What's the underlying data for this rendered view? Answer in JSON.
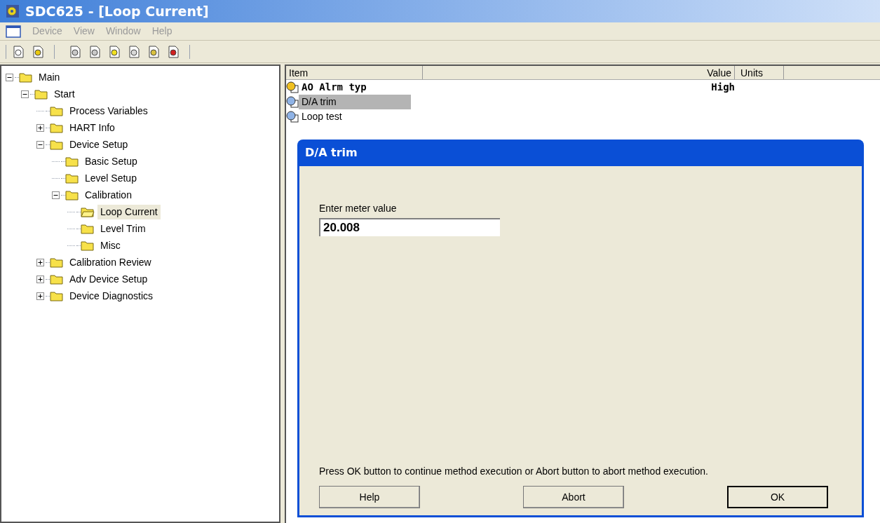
{
  "window": {
    "title": "SDC625 - [Loop Current]"
  },
  "menu": [
    {
      "label": "Device",
      "disabled": true
    },
    {
      "label": "View",
      "disabled": true
    },
    {
      "label": "Window",
      "disabled": true
    },
    {
      "label": "Help",
      "disabled": true
    }
  ],
  "tree": [
    {
      "label": "Main",
      "expanded": true,
      "selected": false,
      "children": [
        {
          "label": "Start",
          "expanded": true,
          "selected": false,
          "children": [
            {
              "label": "Process Variables",
              "selected": false
            },
            {
              "label": "HART Info",
              "expanded": false,
              "selected": false
            },
            {
              "label": "Device Setup",
              "expanded": true,
              "selected": false,
              "children": [
                {
                  "label": "Basic Setup",
                  "selected": false
                },
                {
                  "label": "Level Setup",
                  "selected": false
                },
                {
                  "label": "Calibration",
                  "expanded": true,
                  "selected": false,
                  "children": [
                    {
                      "label": "Loop Current",
                      "selected": true
                    },
                    {
                      "label": "Level Trim",
                      "selected": false
                    },
                    {
                      "label": "Misc",
                      "selected": false
                    }
                  ]
                }
              ]
            },
            {
              "label": "Calibration Review",
              "expanded": false,
              "selected": false
            },
            {
              "label": "Adv Device Setup",
              "expanded": false,
              "selected": false
            },
            {
              "label": "Device Diagnostics",
              "expanded": false,
              "selected": false
            }
          ]
        }
      ]
    }
  ],
  "list": {
    "columns": [
      "Item",
      "Value",
      "Units"
    ],
    "rows": [
      {
        "kind": "variable",
        "item": "AO Alrm typ",
        "value": "High",
        "selected": false
      },
      {
        "kind": "method",
        "item": "D/A trim",
        "selected": true
      },
      {
        "kind": "method",
        "item": "Loop test",
        "selected": false
      }
    ]
  },
  "dialog": {
    "title": "D/A trim",
    "field_label": "Enter meter value",
    "value": "20.008",
    "message": "Press OK button to continue method execution or Abort button to abort method execution.",
    "buttons": [
      {
        "label": "Help",
        "default": false
      },
      {
        "label": "Abort",
        "default": false
      },
      {
        "label": "OK",
        "default": true
      }
    ]
  }
}
